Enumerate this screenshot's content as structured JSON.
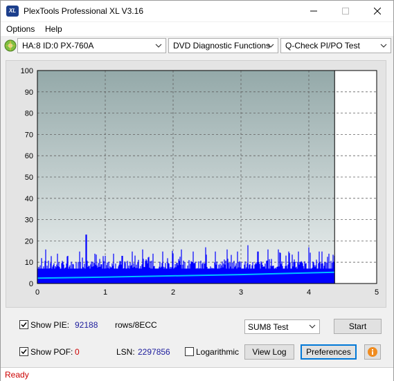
{
  "window": {
    "title": "PlexTools Professional XL V3.16",
    "icon_text": "XL"
  },
  "menu": {
    "options": "Options",
    "help": "Help"
  },
  "toolbar": {
    "drive": "HA:8 ID:0  PX-760A",
    "function": "DVD Diagnostic Functions",
    "test": "Q-Check PI/PO Test"
  },
  "chart_data": {
    "type": "bar",
    "title": "",
    "xlabel": "",
    "ylabel": "",
    "xlim": [
      0,
      5
    ],
    "ylim": [
      0,
      100
    ],
    "x_ticks": [
      "0",
      "1",
      "2",
      "3",
      "4",
      "5"
    ],
    "y_ticks": [
      "0",
      "10",
      "20",
      "30",
      "40",
      "50",
      "60",
      "70",
      "80",
      "90",
      "100"
    ],
    "grid": true,
    "data_end_x": 4.38,
    "series": [
      {
        "color": "#0000ff",
        "kind": "bars",
        "baseline_avg": 9,
        "peaks": [
          [
            0.12,
            16
          ],
          [
            0.3,
            14
          ],
          [
            0.45,
            13
          ],
          [
            0.62,
            15
          ],
          [
            0.72,
            23
          ],
          [
            0.85,
            14
          ],
          [
            1.0,
            13
          ],
          [
            1.12,
            14
          ],
          [
            1.25,
            13
          ],
          [
            1.4,
            15
          ],
          [
            1.55,
            16
          ],
          [
            1.7,
            14
          ],
          [
            1.85,
            15
          ],
          [
            2.0,
            14
          ],
          [
            2.12,
            16
          ],
          [
            2.3,
            15
          ],
          [
            2.48,
            17
          ],
          [
            2.62,
            15
          ],
          [
            2.8,
            16
          ],
          [
            2.95,
            15
          ],
          [
            3.1,
            18
          ],
          [
            3.25,
            15
          ],
          [
            3.4,
            16
          ],
          [
            3.55,
            16
          ],
          [
            3.7,
            15
          ],
          [
            3.85,
            15
          ],
          [
            4.0,
            17
          ],
          [
            4.15,
            15
          ],
          [
            4.3,
            14
          ]
        ]
      },
      {
        "color": "#00c0ff",
        "kind": "line",
        "points": [
          [
            0,
            2.5
          ],
          [
            1,
            3.0
          ],
          [
            2,
            3.6
          ],
          [
            3,
            4.2
          ],
          [
            4,
            5.0
          ],
          [
            4.38,
            5.3
          ]
        ]
      }
    ]
  },
  "bottom": {
    "show_pie_label": "Show PIE:",
    "pie_value": "92188",
    "rows_label": "rows/8ECC",
    "show_poe_label": "Show POF:",
    "poe_value": "0",
    "lsn_label": "LSN:",
    "lsn_value": "2297856",
    "log_label": "Logarithmic",
    "sum_select": "SUM8 Test",
    "start_btn": "Start",
    "viewlog_btn": "View Log",
    "pref_btn": "Preferences"
  },
  "status": {
    "text": "Ready"
  },
  "colors": {
    "status": "#cc0000",
    "pie_value": "#1c1c9c",
    "poe_value": "#cc0000",
    "bars": "#0000ff",
    "avg_line": "#00c0ff"
  }
}
